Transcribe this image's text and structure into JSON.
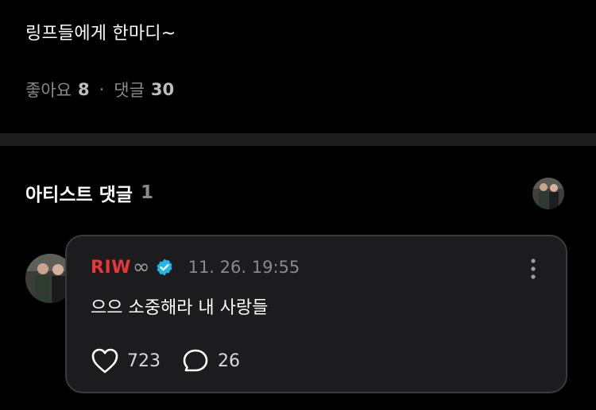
{
  "post": {
    "text": "링프들에게 한마디~",
    "likes_label": "좋아요",
    "likes_count": "8",
    "separator": "·",
    "comments_label": "댓글",
    "comments_count": "30"
  },
  "artist_section": {
    "title": "아티스트 댓글",
    "count": "1"
  },
  "comment": {
    "author": "RIW",
    "author_suffix_icon": "infinity-icon",
    "verified_icon": "verified-badge-icon",
    "verified_color": "#1fb6e8",
    "author_color": "#e53935",
    "timestamp": "11. 26. 19:55",
    "text": "으으 소중해라 내 사랑들",
    "likes": "723",
    "replies": "26"
  }
}
